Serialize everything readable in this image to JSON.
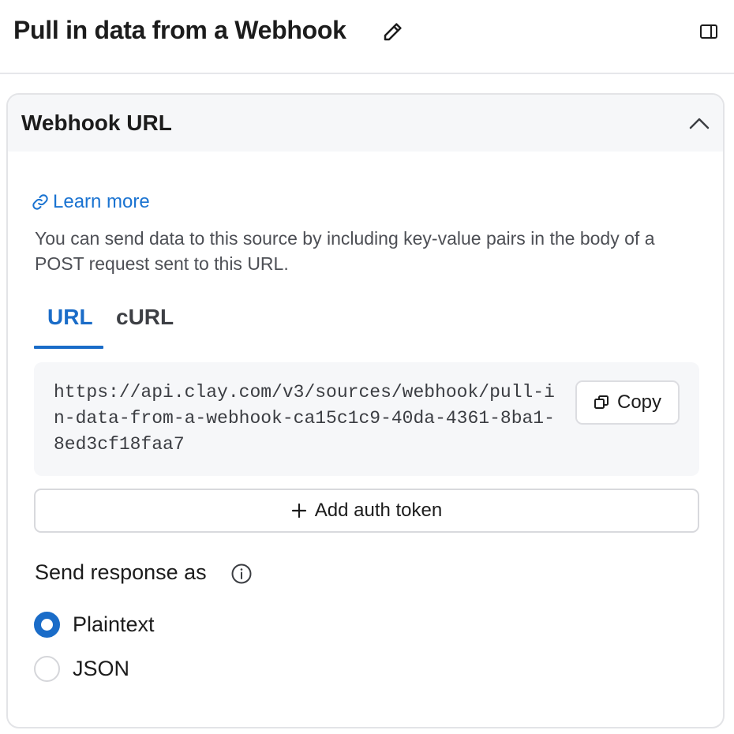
{
  "header": {
    "title": "Pull in data from a Webhook"
  },
  "icons": {
    "edit": "pencil-icon",
    "panel": "sidebar-panel-icon",
    "collapse": "chevron-up-icon",
    "link": "link-icon",
    "copy": "copy-icon",
    "add": "plus-icon",
    "info": "info-icon"
  },
  "card": {
    "title": "Webhook URL",
    "learn_more": "Learn more",
    "description": "You can send data to this source by including key-value pairs in the body of a POST request sent to this URL.",
    "tabs": [
      {
        "label": "URL",
        "active": true
      },
      {
        "label": "cURL",
        "active": false
      }
    ],
    "url": "https://api.clay.com/v3/sources/webhook/pull-in-data-from-a-webhook-ca15c1c9-40da-4361-8ba1-8ed3cf18faa7",
    "copy_label": "Copy",
    "auth_label": "Add auth token",
    "response": {
      "label": "Send response as",
      "options": [
        {
          "label": "Plaintext",
          "selected": true
        },
        {
          "label": "JSON",
          "selected": false
        }
      ]
    }
  },
  "colors": {
    "accent": "#1a6cc8",
    "link": "#1a73d1",
    "border": "#e3e4e7",
    "muted_bg": "#f6f7f9"
  }
}
